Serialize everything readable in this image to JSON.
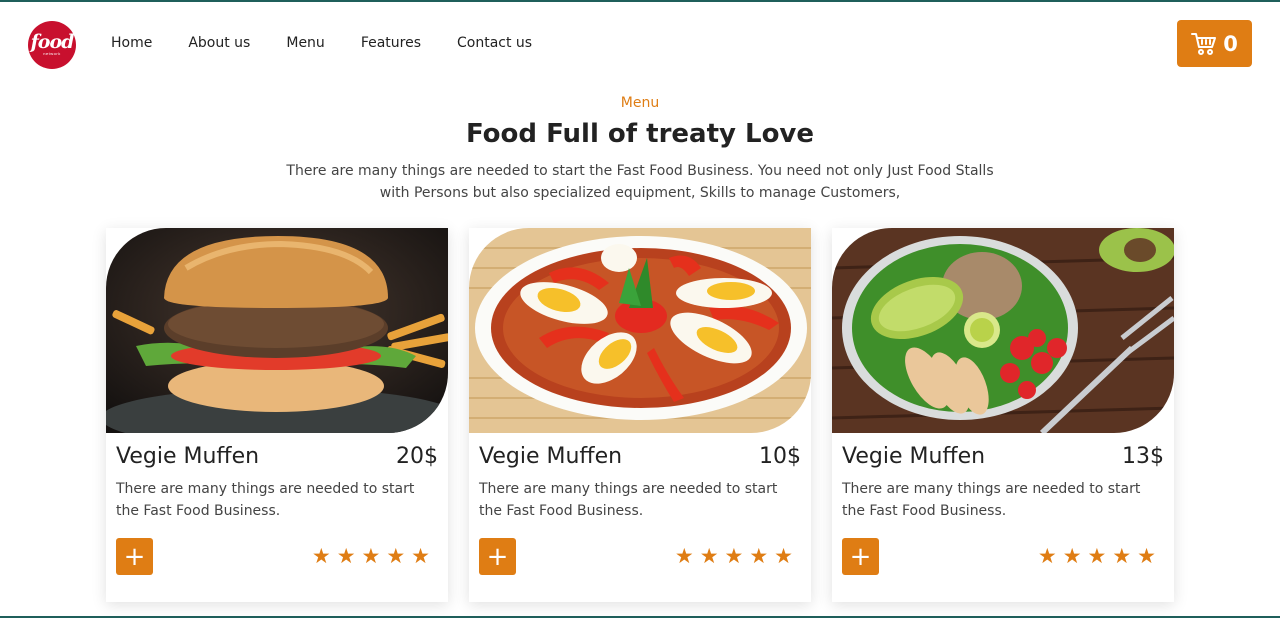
{
  "brand": {
    "logo_text": "food",
    "logo_subtext": "network"
  },
  "nav": {
    "items": [
      "Home",
      "About us",
      "Menu",
      "Features",
      "Contact us"
    ]
  },
  "cart": {
    "count": "0",
    "icon": "cart-icon"
  },
  "section": {
    "eyebrow": "Menu",
    "title": "Food Full of treaty Love",
    "description": "There are many things are needed to start the Fast Food Business. You need not only Just Food Stalls with Persons but also specialized equipment, Skills to manage Customers,"
  },
  "colors": {
    "accent": "#df7d14",
    "logo": "#c8102e",
    "border": "#1f5f5b"
  },
  "cards": [
    {
      "name": "Vegie Muffen",
      "price": "20$",
      "text": "There are many things are needed to start the Fast Food Business.",
      "add_label": "+",
      "rating": 5,
      "image": "burger"
    },
    {
      "name": "Vegie Muffen",
      "price": "10$",
      "text": "There are many things are needed to start the Fast Food Business.",
      "add_label": "+",
      "rating": 5,
      "image": "rice-with-eggs"
    },
    {
      "name": "Vegie Muffen",
      "price": "13$",
      "text": "There are many things are needed to start the Fast Food Business.",
      "add_label": "+",
      "rating": 5,
      "image": "salad-bowl"
    }
  ]
}
